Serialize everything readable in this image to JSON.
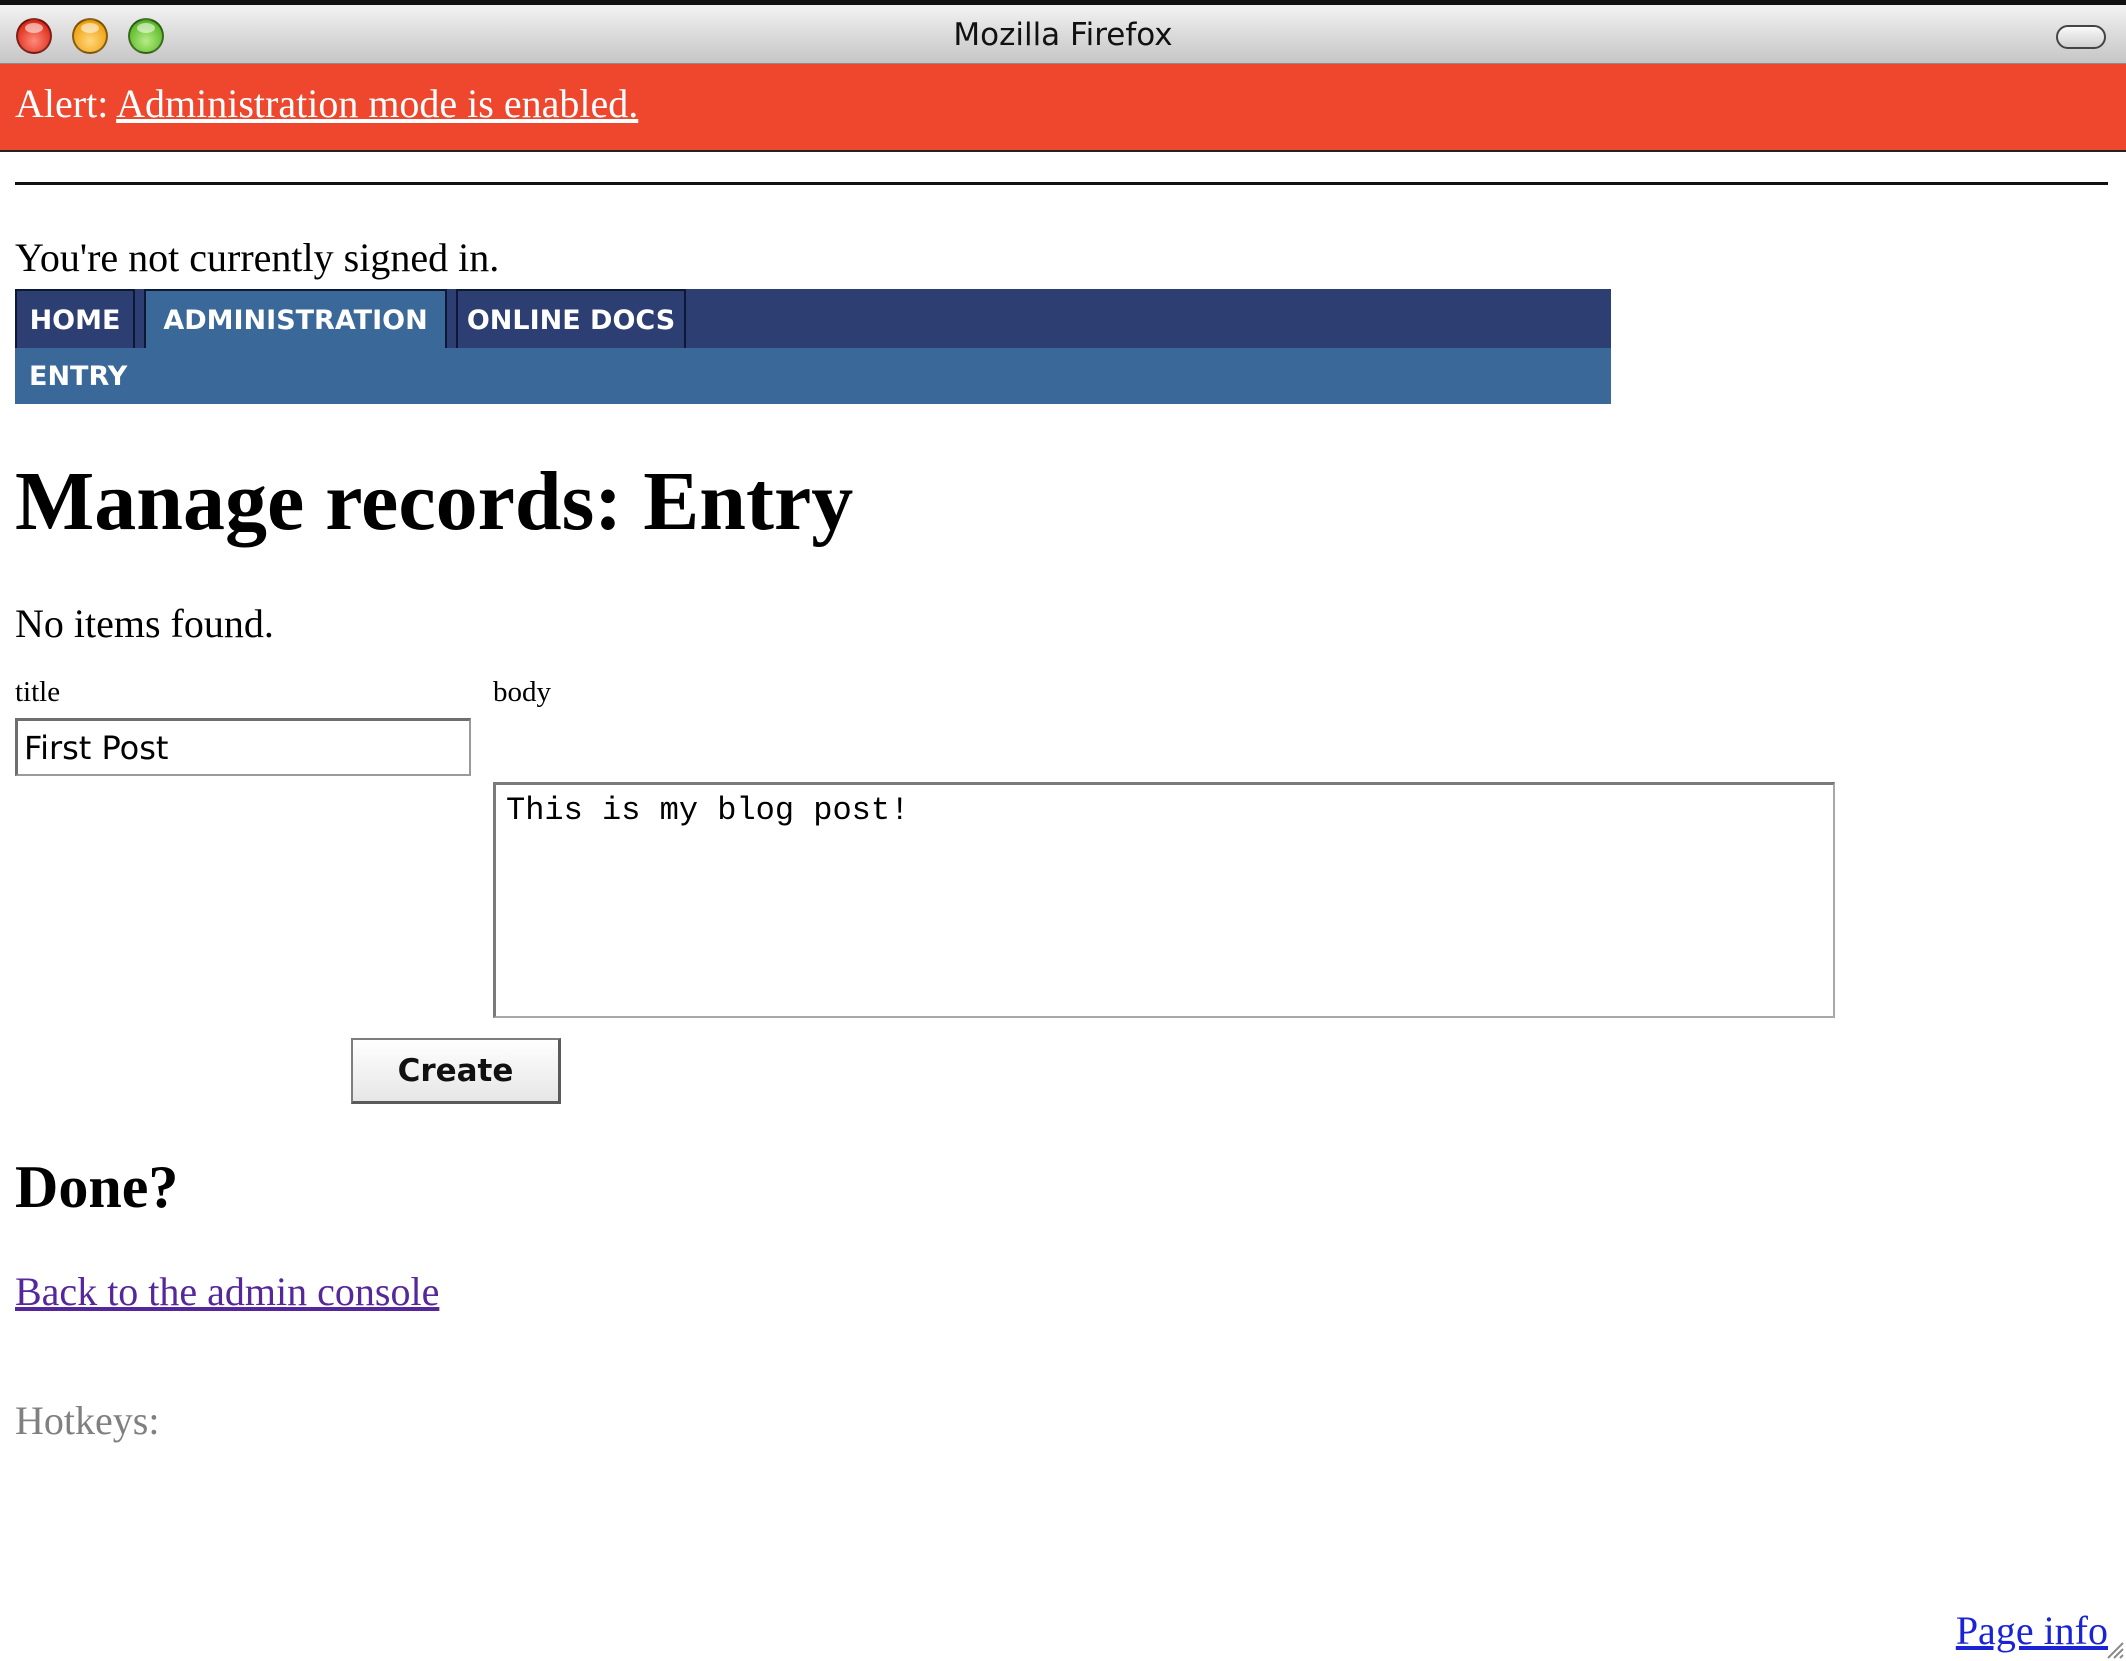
{
  "window": {
    "title": "Mozilla Firefox"
  },
  "alert": {
    "prefix": "Alert:",
    "message": "Administration mode is enabled."
  },
  "session": {
    "status": "You're not currently signed in."
  },
  "nav": {
    "tabs": [
      {
        "label": "HOME",
        "active": false
      },
      {
        "label": "ADMINISTRATION",
        "active": true
      },
      {
        "label": "ONLINE DOCS",
        "active": false
      }
    ],
    "subnav": [
      {
        "label": "ENTRY"
      }
    ]
  },
  "page": {
    "title": "Manage records: Entry",
    "empty_message": "No items found."
  },
  "form": {
    "title_label": "title",
    "title_value": "First Post",
    "body_label": "body",
    "body_value": "This is my blog post!",
    "submit_label": "Create"
  },
  "done": {
    "heading": "Done?",
    "link_text": "Back to the admin console"
  },
  "footer": {
    "hotkeys_label": "Hotkeys:",
    "page_info_link": "Page info"
  },
  "colors": {
    "alert_background": "#ef472e",
    "nav_primary": "#2c3e72",
    "nav_active": "#3a6898",
    "visited_link": "#55279a",
    "link": "#1a24d6"
  }
}
